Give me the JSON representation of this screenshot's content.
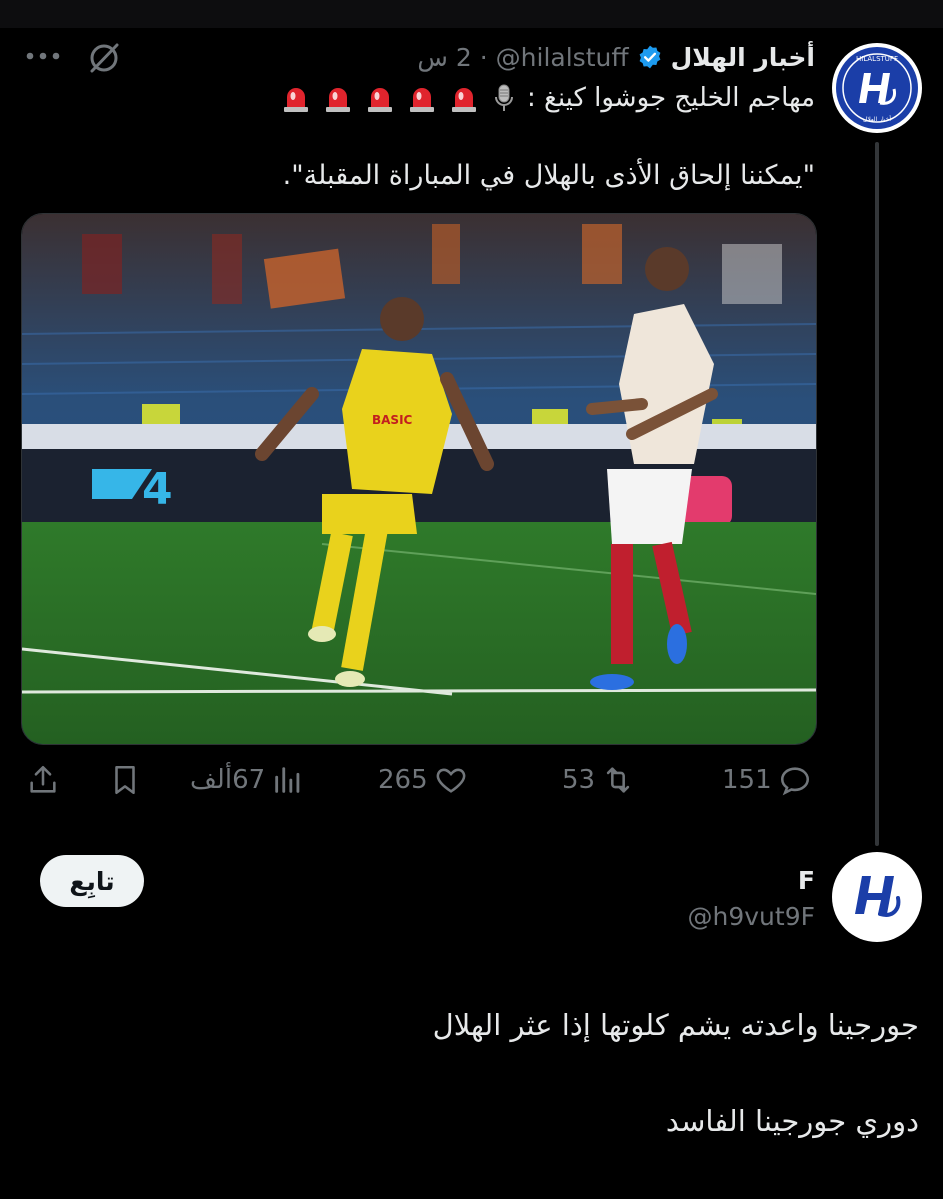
{
  "tweet": {
    "author_name": "أخبار الهلال",
    "handle": "@hilalstuff",
    "time": "2 س",
    "separator": "·",
    "avatar_text_top": "HILALSTUFF",
    "avatar_text_bottom": "أخبار الهلال",
    "headline": "مهاجم الخليج جوشوا كينغ :",
    "siren_count": 5,
    "body": "\"يمكننا إلحاق الأذى بالهلال في المباراة المقبلة\".",
    "photo_sponsor": "BASIC",
    "actions": {
      "replies": "151",
      "retweets": "53",
      "likes": "265",
      "views": "67ألف"
    }
  },
  "reply": {
    "author_name": "F",
    "handle": "@h9vut9F",
    "follow_label": "تابِع",
    "line1": "جورجينا واعدته يشم كلوتها إذا عثر الهلال",
    "line2": "دوري جورجينا الفاسد"
  },
  "colors": {
    "background": "#000000",
    "text": "#e7e9ea",
    "muted": "#71767b",
    "verified": "#1d9bf0",
    "hilal_blue": "#1b3ea8"
  }
}
